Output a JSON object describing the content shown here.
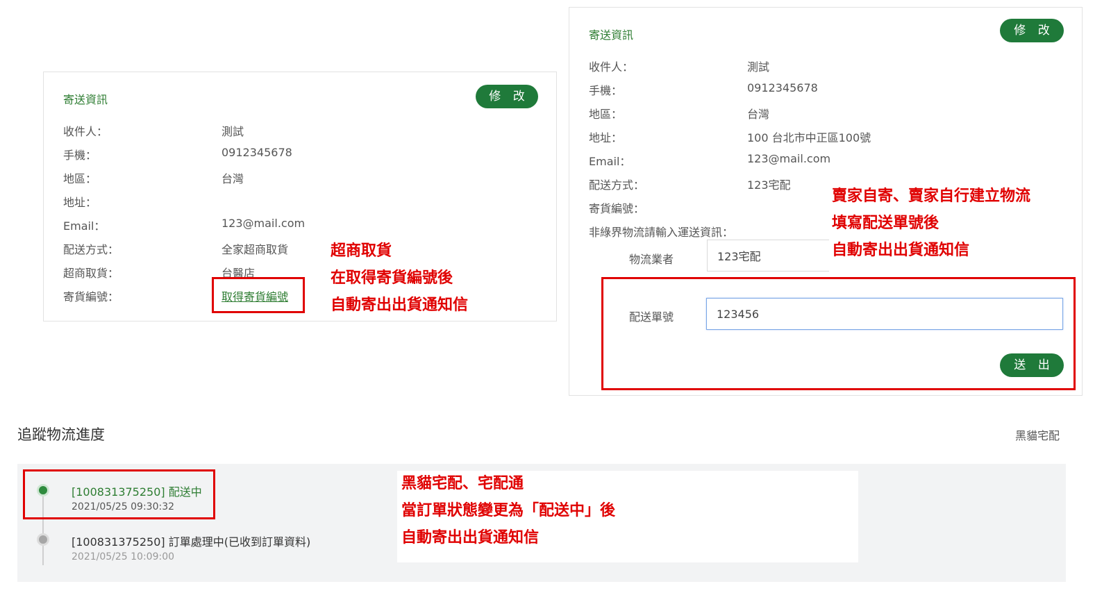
{
  "left_card": {
    "title": "寄送資訊",
    "edit_label": "修 改",
    "rows": [
      {
        "label": "收件人：",
        "value": "測試"
      },
      {
        "label": "手機：",
        "value": "0912345678"
      },
      {
        "label": "地區：",
        "value": "台灣"
      },
      {
        "label": "地址：",
        "value": ""
      },
      {
        "label": "Email：",
        "value": "123@mail.com"
      },
      {
        "label": "配送方式：",
        "value": "全家超商取貨"
      },
      {
        "label": "超商取貨：",
        "value": "台醫店"
      },
      {
        "label": "寄貨編號：",
        "value": "取得寄貨編號"
      }
    ],
    "note": [
      "超商取貨",
      "在取得寄貨編號後",
      "自動寄出出貨通知信"
    ]
  },
  "right_card": {
    "title": "寄送資訊",
    "edit_label": "修 改",
    "rows": [
      {
        "label": "收件人：",
        "value": "測試"
      },
      {
        "label": "手機：",
        "value": "0912345678"
      },
      {
        "label": "地區：",
        "value": "台灣"
      },
      {
        "label": "地址：",
        "value": "100 台北市中正區100號"
      },
      {
        "label": "Email：",
        "value": "123@mail.com"
      },
      {
        "label": "配送方式：",
        "value": "123宅配"
      },
      {
        "label": "寄貨編號：",
        "value": ""
      }
    ],
    "non_green_label": "非綠界物流請輸入運送資訊：",
    "carrier_label": "物流業者",
    "carrier_value": "123宅配",
    "tracking_label": "配送單號",
    "tracking_value": "123456",
    "submit_label": "送 出",
    "note": [
      "賣家自寄、賣家自行建立物流",
      "填寫配送單號後",
      "自動寄出出貨通知信"
    ]
  },
  "tracking": {
    "title": "追蹤物流進度",
    "carrier": "黑貓宅配",
    "events": [
      {
        "text": "[100831375250] 配送中",
        "time": "2021/05/25 09:30:32"
      },
      {
        "text": "[100831375250] 訂單處理中(已收到訂單資料)",
        "time": "2021/05/25 10:09:00"
      }
    ],
    "note": [
      "黑貓宅配、宅配通",
      "當訂單狀態變更為「配送中」後",
      "自動寄出出貨通知信"
    ]
  },
  "colors": {
    "accent": "#1f7a3a",
    "annotation": "#e00000"
  }
}
